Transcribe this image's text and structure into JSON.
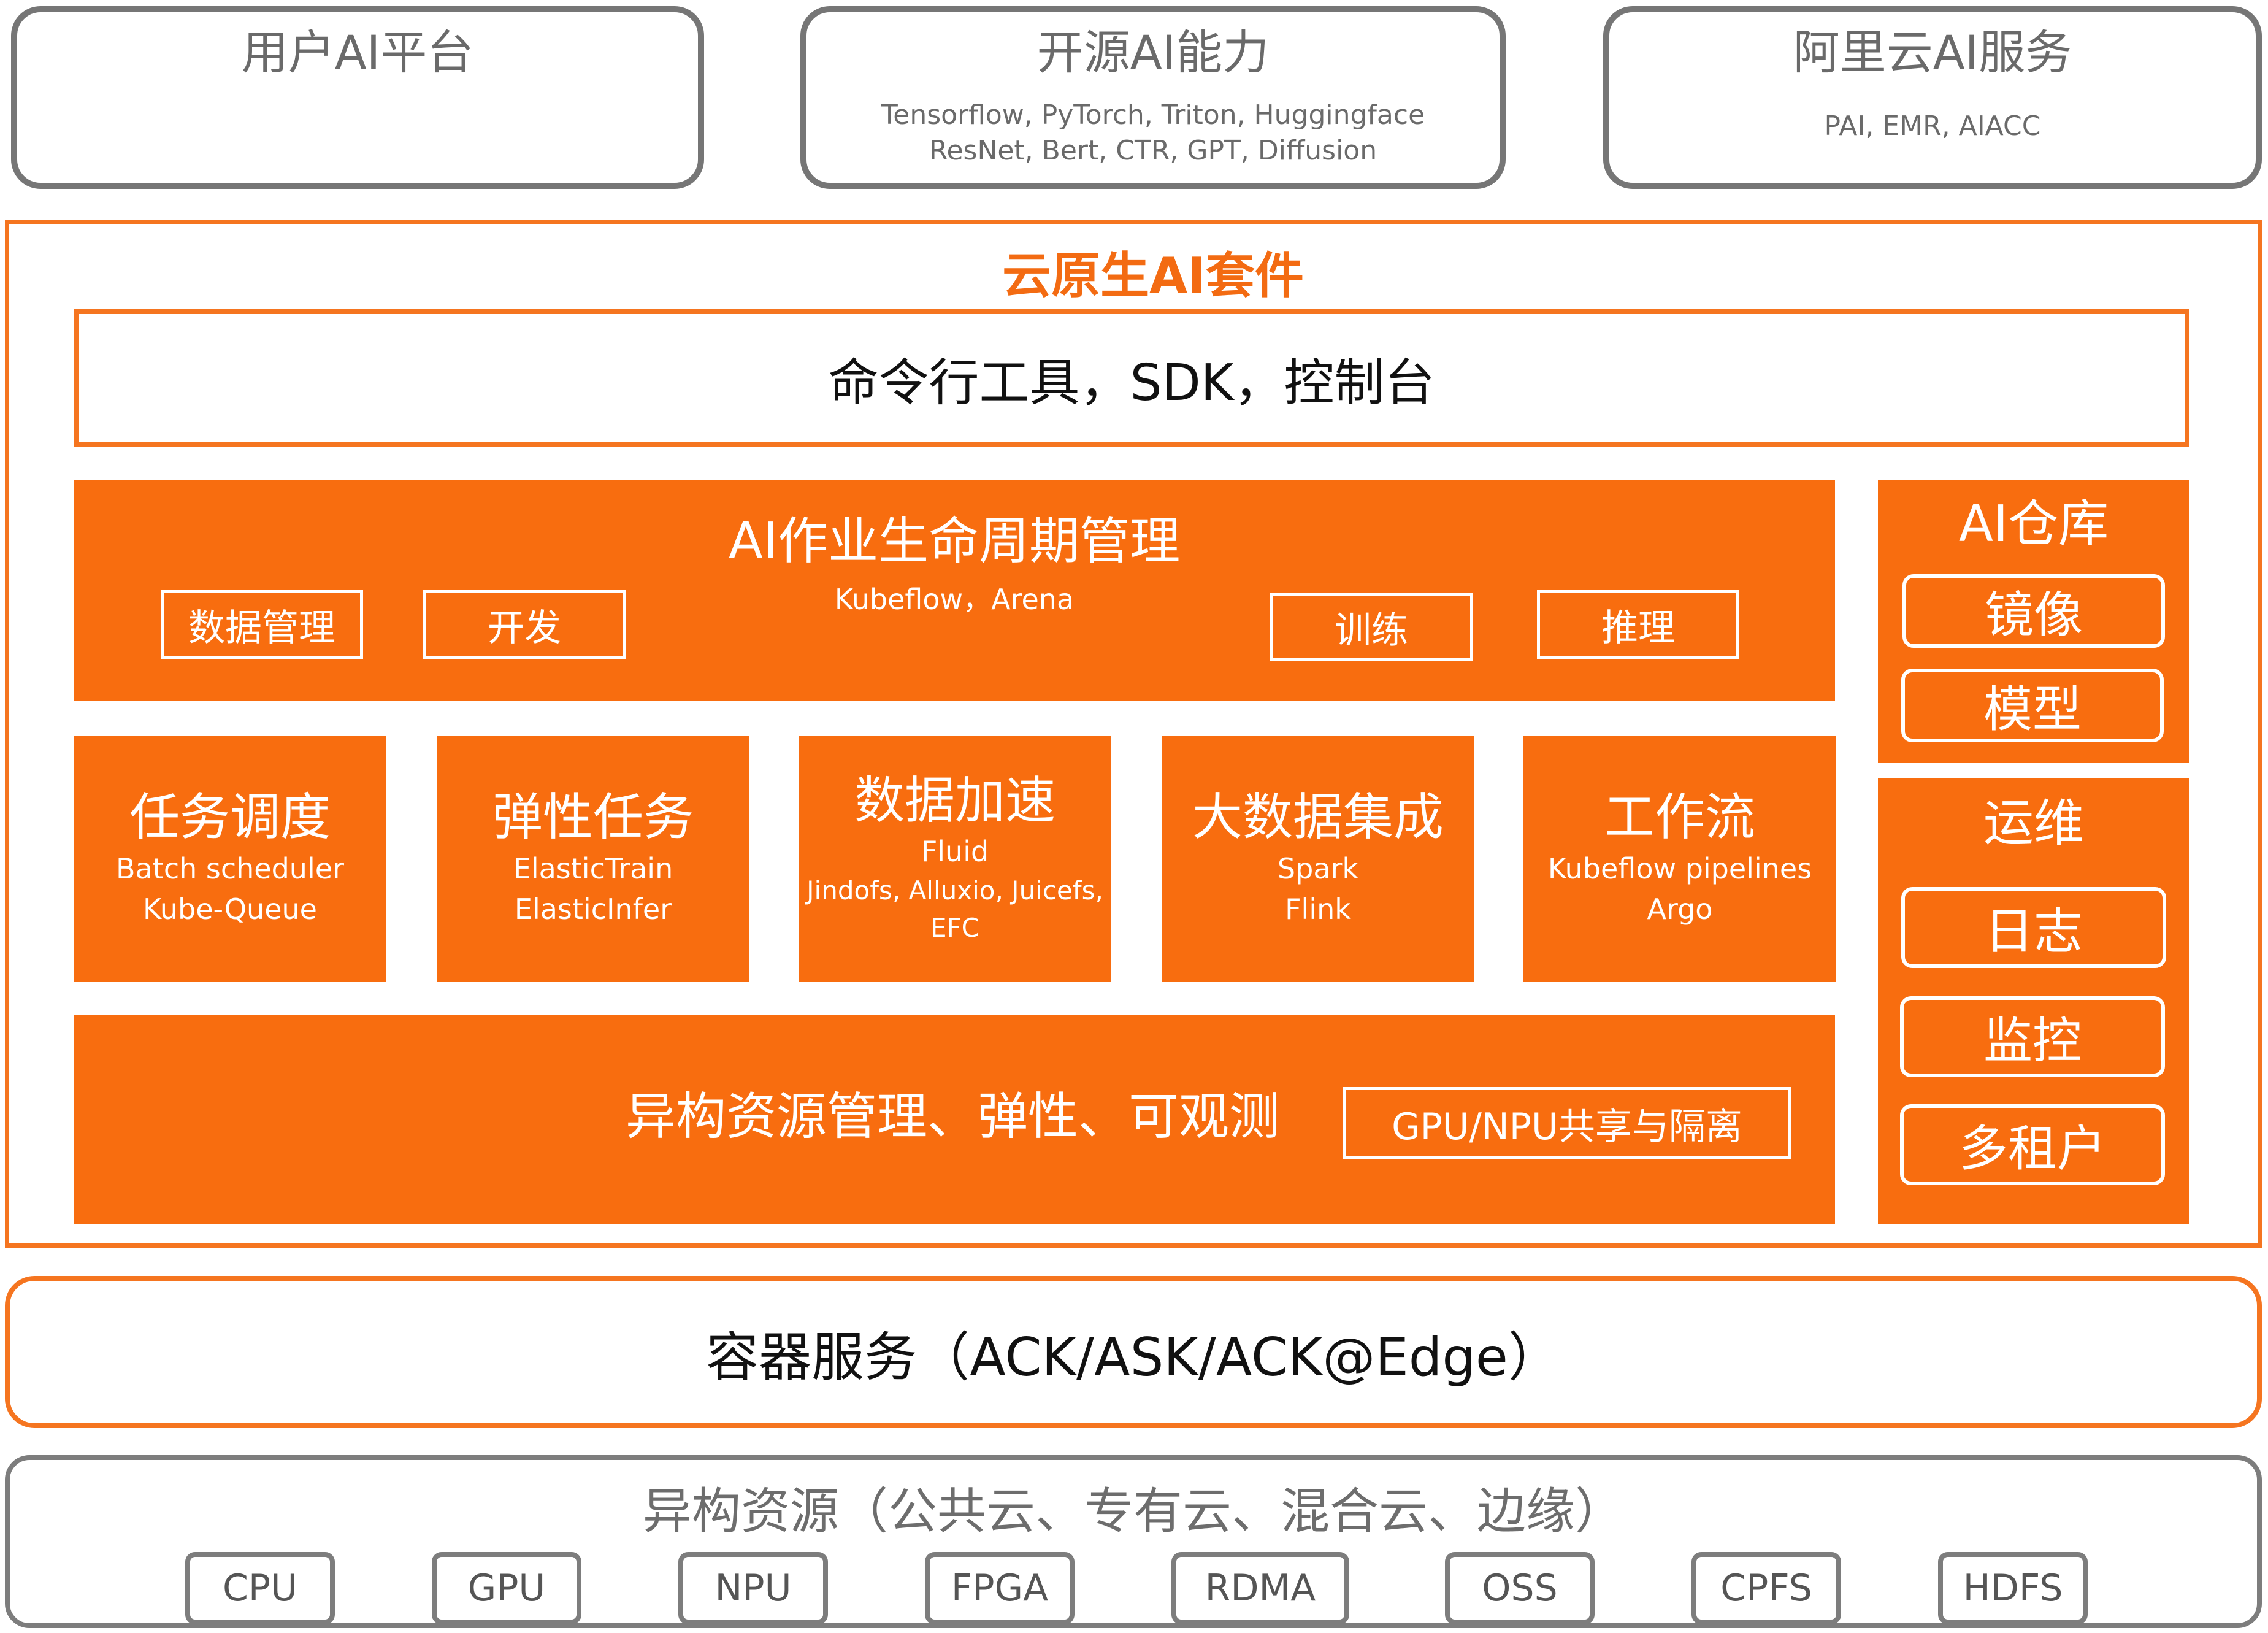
{
  "top": [
    {
      "title": "用户AI平台",
      "lines": []
    },
    {
      "title": "开源AI能力",
      "lines": [
        "Tensorflow, PyTorch, Triton, Huggingface",
        "ResNet, Bert, CTR, GPT, Diffusion"
      ]
    },
    {
      "title": "阿里云AI服务",
      "lines": [
        "PAI, EMR, AIACC"
      ]
    }
  ],
  "suite": {
    "title": "云原生AI套件",
    "cli": "命令行工具，SDK，控制台",
    "lifecycle": {
      "title": "AI作业生命周期管理",
      "subtitle": "Kubeflow，Arena",
      "tags": [
        "数据管理",
        "开发",
        "训练",
        "推理"
      ]
    },
    "modules": [
      {
        "title": "任务调度",
        "lines": [
          "Batch scheduler",
          "Kube-Queue"
        ]
      },
      {
        "title": "弹性任务",
        "lines": [
          "ElasticTrain",
          "ElasticInfer"
        ]
      },
      {
        "title": "数据加速",
        "lines": [
          "Fluid",
          "Jindofs, Alluxio, Juicefs,",
          "EFC"
        ]
      },
      {
        "title": "大数据集成",
        "lines": [
          "Spark",
          "Flink"
        ]
      },
      {
        "title": "工作流",
        "lines": [
          "Kubeflow pipelines",
          "Argo"
        ]
      }
    ],
    "resource": {
      "title": "异构资源管理、弹性、可观测",
      "tag": "GPU/NPU共享与隔离"
    },
    "repo": {
      "title": "AI仓库",
      "items": [
        "镜像",
        "模型"
      ]
    },
    "ops": {
      "title": "运维",
      "items": [
        "日志",
        "监控",
        "多租户"
      ]
    }
  },
  "container": "容器服务（ACK/ASK/ACK@Edge）",
  "hetero": {
    "title": "异构资源（公共云、专有云、混合云、边缘）",
    "chips": [
      "CPU",
      "GPU",
      "NPU",
      "FPGA",
      "RDMA",
      "OSS",
      "CPFS",
      "HDFS"
    ]
  }
}
